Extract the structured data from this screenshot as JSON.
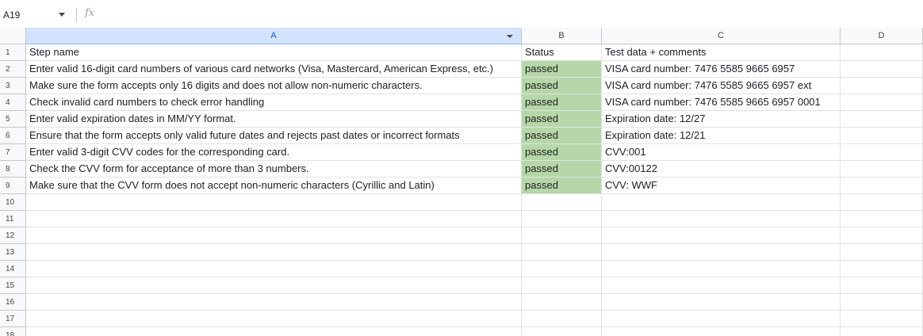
{
  "formula_bar": {
    "cell_ref": "A19",
    "fx_label": "fx"
  },
  "columns": [
    "A",
    "B",
    "C",
    "D"
  ],
  "row_numbers": [
    "1",
    "2",
    "3",
    "4",
    "5",
    "6",
    "7",
    "8",
    "9",
    "10",
    "11",
    "12",
    "13",
    "14",
    "15",
    "16",
    "17",
    "18"
  ],
  "rows": [
    [
      "Step name",
      "Status",
      "Test data + comments",
      ""
    ],
    [
      "Enter valid 16-digit card numbers of various card networks (Visa, Mastercard, American Express, etc.)",
      "passed",
      "VISA card number: 7476 5585 9665 6957",
      ""
    ],
    [
      "Make sure the form accepts only 16 digits and does not allow non-numeric characters.",
      "passed",
      "VISA card number: 7476 5585 9665 6957 ext",
      ""
    ],
    [
      "Check invalid card numbers to check error handling",
      "passed",
      "VISA card number: 7476 5585 9665 6957 0001",
      ""
    ],
    [
      "Enter valid expiration dates in MM/YY format.",
      "passed",
      "Expiration date: 12/27",
      ""
    ],
    [
      "Ensure that the form accepts only valid future dates and rejects past dates or incorrect formats",
      "passed",
      "Expiration date: 12/21",
      ""
    ],
    [
      "Enter valid 3-digit CVV codes for the corresponding card.",
      "passed",
      "CVV:001",
      ""
    ],
    [
      "Check the CVV form for acceptance of more than 3 numbers.",
      "passed",
      "CVV:00122",
      ""
    ],
    [
      "Make sure that the CVV form does not accept non-numeric characters (Cyrillic and Latin)",
      "passed",
      "CVV: WWF",
      ""
    ]
  ],
  "colors": {
    "passed_fill": "#b6d7a8",
    "selected_header": "#d3e3fd",
    "header_bg": "#f8f9fa",
    "gridline": "#e1e3e1"
  }
}
